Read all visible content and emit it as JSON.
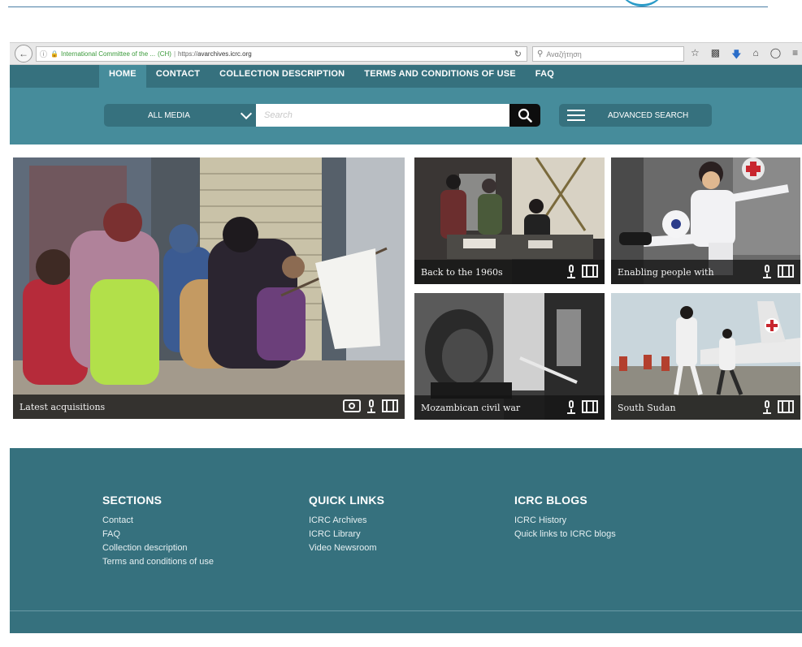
{
  "browser": {
    "url_org": "International Committee of the ...",
    "url_country": "(CH)",
    "url_scheme": "https://",
    "url_host": "avarchives.icrc.org",
    "search_placeholder": "Αναζήτηση"
  },
  "nav": {
    "items": [
      "HOME",
      "CONTACT",
      "COLLECTION DESCRIPTION",
      "TERMS AND CONDITIONS OF USE",
      "FAQ"
    ],
    "active": "HOME"
  },
  "search": {
    "media_label": "ALL MEDIA",
    "placeholder": "Search",
    "advanced_label": "ADVANCED SEARCH"
  },
  "gallery": {
    "tiles": [
      {
        "caption": "Latest acquisitions",
        "media": [
          "camera",
          "mic",
          "film"
        ]
      },
      {
        "caption": "Back to the 1960s",
        "media": [
          "mic",
          "film"
        ]
      },
      {
        "caption": "Enabling people with",
        "media": [
          "mic",
          "film"
        ]
      },
      {
        "caption": "Mozambican civil war",
        "media": [
          "mic",
          "film"
        ]
      },
      {
        "caption": "South Sudan",
        "media": [
          "mic",
          "film"
        ]
      }
    ]
  },
  "footer": {
    "sections": {
      "title": "SECTIONS",
      "links": [
        "Contact",
        "FAQ",
        "Collection description",
        "Terms and conditions of use"
      ]
    },
    "quick_links": {
      "title": "QUICK LINKS",
      "links": [
        "ICRC Archives",
        "ICRC Library",
        "Video Newsroom"
      ]
    },
    "blogs": {
      "title": "ICRC BLOGS",
      "links": [
        "ICRC History",
        "Quick links to ICRC blogs"
      ]
    }
  },
  "colors": {
    "nav_bg": "#36717e",
    "band_bg": "#468c9b",
    "footer_bg": "#36717e",
    "search_btn": "#0d0d0d"
  }
}
